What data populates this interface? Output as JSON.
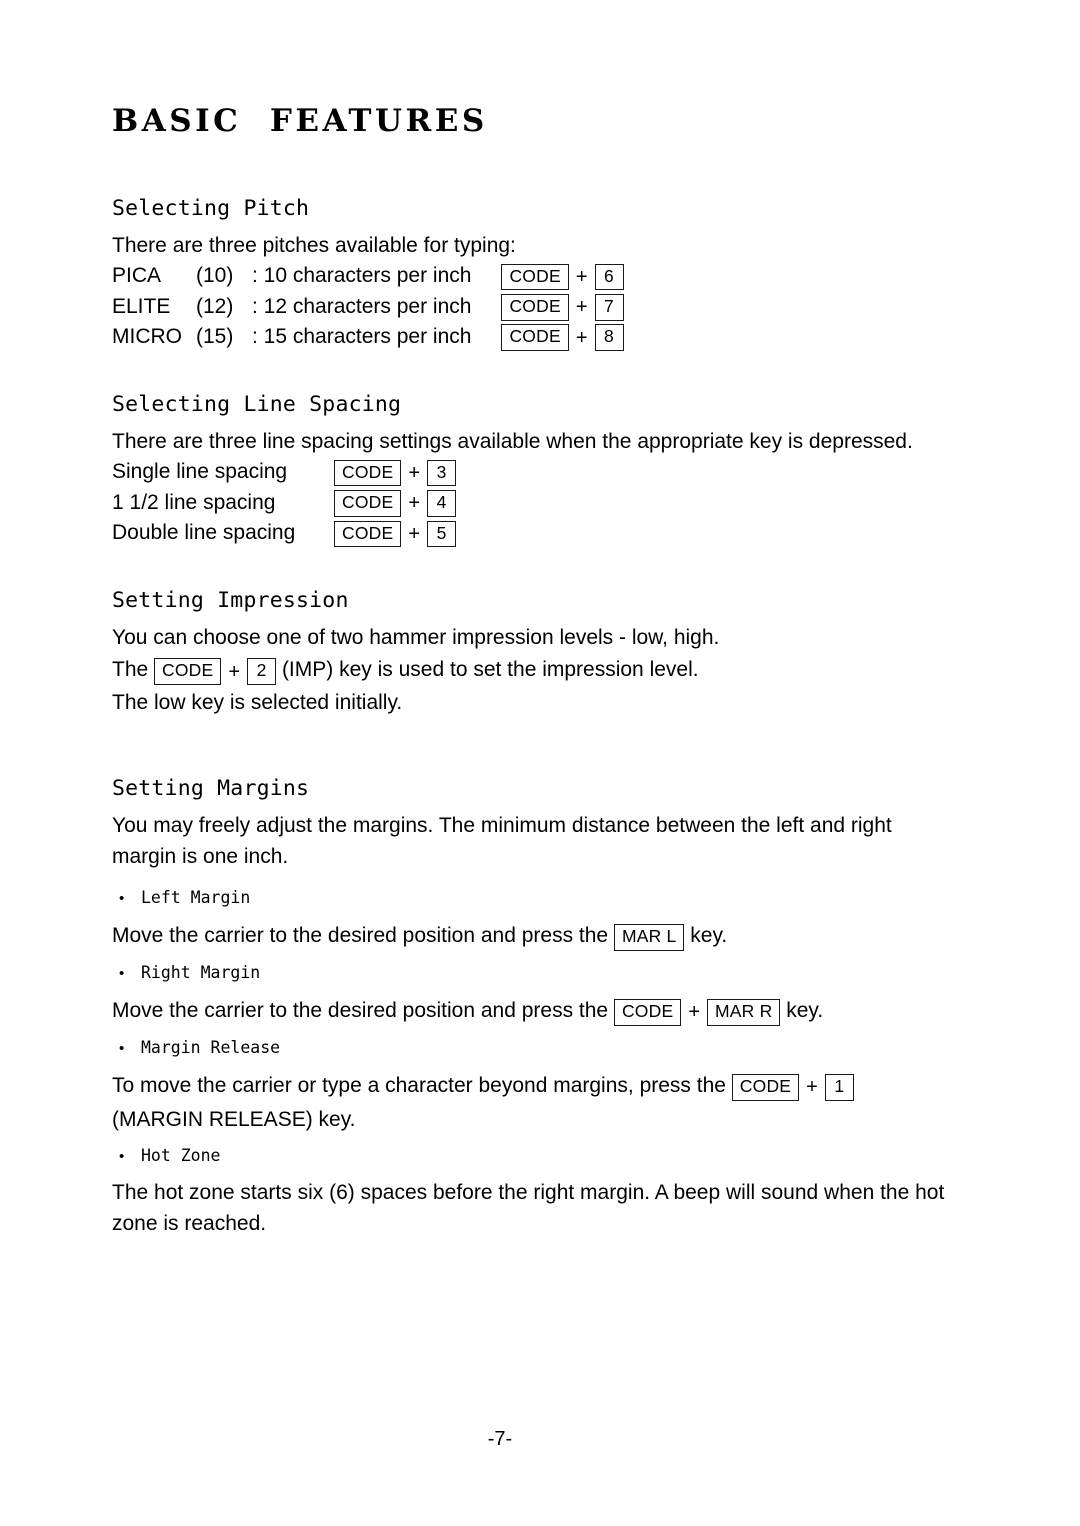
{
  "document": {
    "title": "BASIC  FEATURES",
    "page_number": "-7-"
  },
  "sections": {
    "pitch": {
      "heading": "Selecting Pitch",
      "intro": "There are three pitches available for typing:",
      "rows": [
        {
          "name": "PICA",
          "paren": "(10)",
          "desc": ": 10 characters per inch",
          "key1": "CODE",
          "plus": "+",
          "key2": "6"
        },
        {
          "name": "ELITE",
          "paren": "(12)",
          "desc": ": 12 characters per inch",
          "key1": "CODE",
          "plus": "+",
          "key2": "7"
        },
        {
          "name": "MICRO",
          "paren": "(15)",
          "desc": ": 15 characters per inch",
          "key1": "CODE",
          "plus": "+",
          "key2": "8"
        }
      ]
    },
    "line_spacing": {
      "heading": "Selecting Line Spacing",
      "intro": "There are three line spacing settings available when the appropriate key is depressed.",
      "rows": [
        {
          "label": "Single line spacing",
          "key1": "CODE",
          "plus": "+",
          "key2": "3"
        },
        {
          "label": "1 1/2 line spacing",
          "key1": "CODE",
          "plus": "+",
          "key2": "4"
        },
        {
          "label": "Double line spacing",
          "key1": "CODE",
          "plus": "+",
          "key2": "5"
        }
      ]
    },
    "impression": {
      "heading": "Setting Impression",
      "line1": "You can choose one of two hammer impression levels - low, high.",
      "line2_pre": "The",
      "line2_key1": "CODE",
      "line2_plus": "+",
      "line2_key2": "2",
      "line2_post": "(IMP) key is used to set the impression level.",
      "line3": "The low key is selected initially."
    },
    "margins": {
      "heading": "Setting Margins",
      "intro": "You may freely adjust the margins. The minimum distance between the left and right margin is one inch.",
      "bullet_char": "•",
      "items": [
        {
          "label": "Left Margin",
          "text_pre": "Move the carrier to the desired position and press the",
          "key1": "MAR L",
          "plus": "",
          "key2": "",
          "text_post": "key."
        },
        {
          "label": "Right Margin",
          "text_pre": "Move the carrier to the desired position and press the",
          "key1": "CODE",
          "plus": "+",
          "key2": "MAR R",
          "text_post": "key."
        },
        {
          "label": "Margin Release",
          "text_pre": "To move the carrier or type a character beyond margins, press the",
          "key1": "CODE",
          "plus": "+",
          "key2": "1",
          "text_post": "(MARGIN RELEASE) key."
        },
        {
          "label": "Hot Zone",
          "text_pre": "The hot zone starts six (6) spaces before the right margin. A beep will sound when the hot zone is reached.",
          "key1": "",
          "plus": "",
          "key2": "",
          "text_post": ""
        }
      ]
    }
  }
}
